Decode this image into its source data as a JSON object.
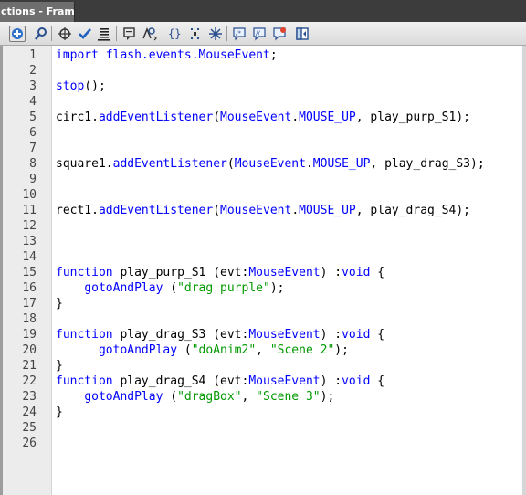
{
  "panel": {
    "title": "ctions - Frame"
  },
  "toolbar": {
    "buttons": [
      {
        "name": "add-script-item-icon"
      },
      {
        "name": "find-icon"
      },
      {
        "name": "insert-target-path-icon"
      },
      {
        "name": "check-syntax-icon"
      },
      {
        "name": "auto-format-icon"
      },
      {
        "name": "code-hint-icon"
      },
      {
        "name": "debug-options-icon"
      },
      {
        "name": "collapse-between-braces-icon"
      },
      {
        "name": "collapse-selection-icon"
      },
      {
        "name": "expand-all-icon"
      },
      {
        "name": "apply-block-comment-icon"
      },
      {
        "name": "apply-line-comment-icon"
      },
      {
        "name": "remove-comment-icon"
      },
      {
        "name": "show-hide-toolbox-icon"
      }
    ]
  },
  "editor": {
    "colors": {
      "keyword": "#0000ff",
      "string": "#009900",
      "plain": "#000000",
      "gutter": "#ececec"
    },
    "lines": [
      {
        "n": "1",
        "tokens": [
          {
            "t": "import flash.events.MouseEvent",
            "c": "kw"
          },
          {
            "t": ";",
            "c": ""
          }
        ]
      },
      {
        "n": "2",
        "tokens": []
      },
      {
        "n": "3",
        "tokens": [
          {
            "t": "stop",
            "c": "kw"
          },
          {
            "t": "();",
            "c": ""
          }
        ]
      },
      {
        "n": "4",
        "tokens": []
      },
      {
        "n": "5",
        "tokens": [
          {
            "t": "circ1.",
            "c": ""
          },
          {
            "t": "addEventListener",
            "c": "kw"
          },
          {
            "t": "(",
            "c": ""
          },
          {
            "t": "MouseEvent",
            "c": "kw"
          },
          {
            "t": ".",
            "c": ""
          },
          {
            "t": "MOUSE_UP",
            "c": "kw"
          },
          {
            "t": ", play_purp_S1);",
            "c": ""
          }
        ]
      },
      {
        "n": "6",
        "tokens": []
      },
      {
        "n": "7",
        "tokens": []
      },
      {
        "n": "8",
        "tokens": [
          {
            "t": "square1.",
            "c": ""
          },
          {
            "t": "addEventListener",
            "c": "kw"
          },
          {
            "t": "(",
            "c": ""
          },
          {
            "t": "MouseEvent",
            "c": "kw"
          },
          {
            "t": ".",
            "c": ""
          },
          {
            "t": "MOUSE_UP",
            "c": "kw"
          },
          {
            "t": ", play_drag_S3);",
            "c": ""
          }
        ]
      },
      {
        "n": "9",
        "tokens": []
      },
      {
        "n": "10",
        "tokens": []
      },
      {
        "n": "11",
        "tokens": [
          {
            "t": "rect1.",
            "c": ""
          },
          {
            "t": "addEventListener",
            "c": "kw"
          },
          {
            "t": "(",
            "c": ""
          },
          {
            "t": "MouseEvent",
            "c": "kw"
          },
          {
            "t": ".",
            "c": ""
          },
          {
            "t": "MOUSE_UP",
            "c": "kw"
          },
          {
            "t": ", play_drag_S4);",
            "c": ""
          }
        ]
      },
      {
        "n": "12",
        "tokens": []
      },
      {
        "n": "13",
        "tokens": []
      },
      {
        "n": "14",
        "tokens": []
      },
      {
        "n": "15",
        "tokens": [
          {
            "t": "function",
            "c": "kw"
          },
          {
            "t": " play_purp_S1 (evt:",
            "c": ""
          },
          {
            "t": "MouseEvent",
            "c": "kw"
          },
          {
            "t": ") :",
            "c": ""
          },
          {
            "t": "void",
            "c": "kw"
          },
          {
            "t": " {",
            "c": ""
          }
        ]
      },
      {
        "n": "16",
        "tokens": [
          {
            "t": "    ",
            "c": ""
          },
          {
            "t": "gotoAndPlay",
            "c": "kw"
          },
          {
            "t": " (",
            "c": ""
          },
          {
            "t": "\"drag purple\"",
            "c": "str"
          },
          {
            "t": ");",
            "c": ""
          }
        ]
      },
      {
        "n": "17",
        "tokens": [
          {
            "t": "}",
            "c": ""
          }
        ]
      },
      {
        "n": "18",
        "tokens": []
      },
      {
        "n": "19",
        "tokens": [
          {
            "t": "function",
            "c": "kw"
          },
          {
            "t": " play_drag_S3 (evt:",
            "c": ""
          },
          {
            "t": "MouseEvent",
            "c": "kw"
          },
          {
            "t": ") :",
            "c": ""
          },
          {
            "t": "void",
            "c": "kw"
          },
          {
            "t": " {",
            "c": ""
          }
        ]
      },
      {
        "n": "20",
        "tokens": [
          {
            "t": "      ",
            "c": ""
          },
          {
            "t": "gotoAndPlay",
            "c": "kw"
          },
          {
            "t": " (",
            "c": ""
          },
          {
            "t": "\"doAnim2\"",
            "c": "str"
          },
          {
            "t": ", ",
            "c": ""
          },
          {
            "t": "\"Scene 2\"",
            "c": "str"
          },
          {
            "t": ");",
            "c": ""
          }
        ]
      },
      {
        "n": "21",
        "tokens": [
          {
            "t": "}",
            "c": ""
          }
        ]
      },
      {
        "n": "22",
        "tokens": [
          {
            "t": "function",
            "c": "kw"
          },
          {
            "t": " play_drag_S4 (evt:",
            "c": ""
          },
          {
            "t": "MouseEvent",
            "c": "kw"
          },
          {
            "t": ") :",
            "c": ""
          },
          {
            "t": "void",
            "c": "kw"
          },
          {
            "t": " {",
            "c": ""
          }
        ]
      },
      {
        "n": "23",
        "tokens": [
          {
            "t": "    ",
            "c": ""
          },
          {
            "t": "gotoAndPlay",
            "c": "kw"
          },
          {
            "t": " (",
            "c": ""
          },
          {
            "t": "\"dragBox\"",
            "c": "str"
          },
          {
            "t": ", ",
            "c": ""
          },
          {
            "t": "\"Scene 3\"",
            "c": "str"
          },
          {
            "t": ");",
            "c": ""
          }
        ]
      },
      {
        "n": "24",
        "tokens": [
          {
            "t": "}",
            "c": ""
          }
        ]
      },
      {
        "n": "25",
        "tokens": []
      },
      {
        "n": "26",
        "tokens": []
      }
    ]
  }
}
